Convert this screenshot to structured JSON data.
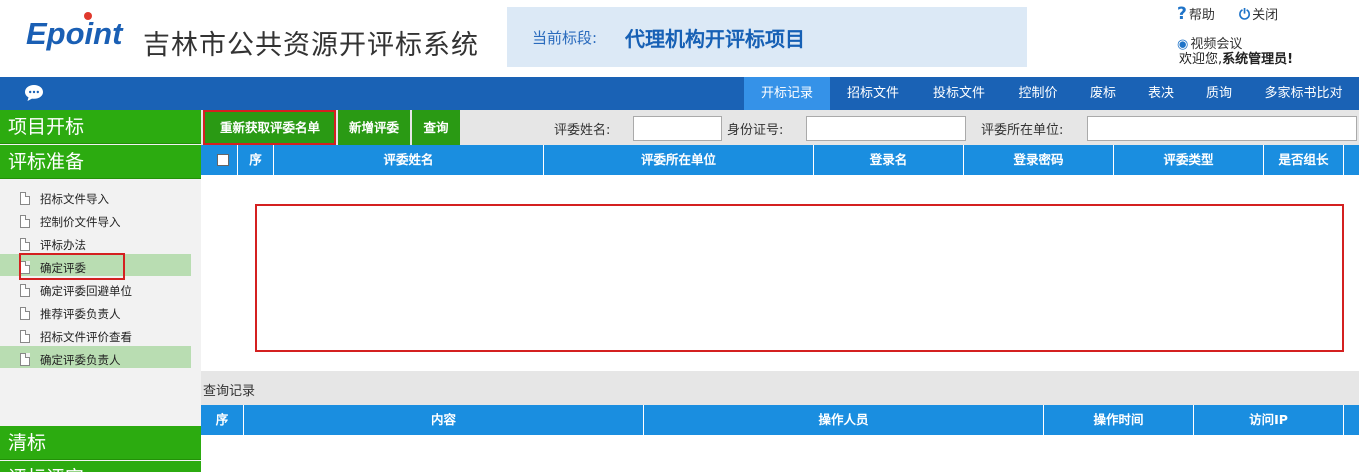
{
  "header": {
    "logo_text": "Epoint",
    "app_title": "吉林市公共资源开评标系统",
    "stage_label": "当前标段:",
    "stage_value": "代理机构开评标项目",
    "help_label": "帮助",
    "close_label": "关闭",
    "video_label": "视频会议",
    "welcome_prefix": "欢迎您,",
    "user_name": "系统管理员!"
  },
  "nav": {
    "tabs": [
      {
        "label": "开标记录",
        "active": true
      },
      {
        "label": "招标文件",
        "active": false
      },
      {
        "label": "投标文件",
        "active": false
      },
      {
        "label": "控制价",
        "active": false
      },
      {
        "label": "废标",
        "active": false
      },
      {
        "label": "表决",
        "active": false
      },
      {
        "label": "质询",
        "active": false
      },
      {
        "label": "多家标书比对",
        "active": false
      }
    ]
  },
  "sidebar": {
    "sections": [
      "项目开标",
      "评标准备",
      "清标",
      "评标评审"
    ],
    "items": [
      {
        "label": "招标文件导入",
        "selected": false
      },
      {
        "label": "控制价文件导入",
        "selected": false
      },
      {
        "label": "评标办法",
        "selected": false
      },
      {
        "label": "确定评委",
        "selected": true
      },
      {
        "label": "确定评委回避单位",
        "selected": false
      },
      {
        "label": "推荐评委负责人",
        "selected": false
      },
      {
        "label": "招标文件评价查看",
        "selected": false
      },
      {
        "label": "确定评委负责人",
        "selected": true
      }
    ]
  },
  "toolbar": {
    "refetch_label": "重新获取评委名单",
    "add_label": "新增评委",
    "query_label": "查询",
    "name_label": "评委姓名:",
    "id_label": "身份证号:",
    "unit_label": "评委所在单位:",
    "name_value": "",
    "id_value": "",
    "unit_value": ""
  },
  "experts_table": {
    "columns": [
      "序",
      "评委姓名",
      "评委所在单位",
      "登录名",
      "登录密码",
      "评委类型",
      "是否组长"
    ],
    "rows": []
  },
  "history": {
    "title": "查询记录",
    "columns": [
      "序",
      "内容",
      "操作人员",
      "操作时间",
      "访问IP"
    ],
    "rows": []
  },
  "colors": {
    "brand_blue": "#1a62b5",
    "active_tab": "#3592e8",
    "green": "#2cab10",
    "table_header": "#1a8ee0",
    "highlight_red": "#d42020"
  }
}
